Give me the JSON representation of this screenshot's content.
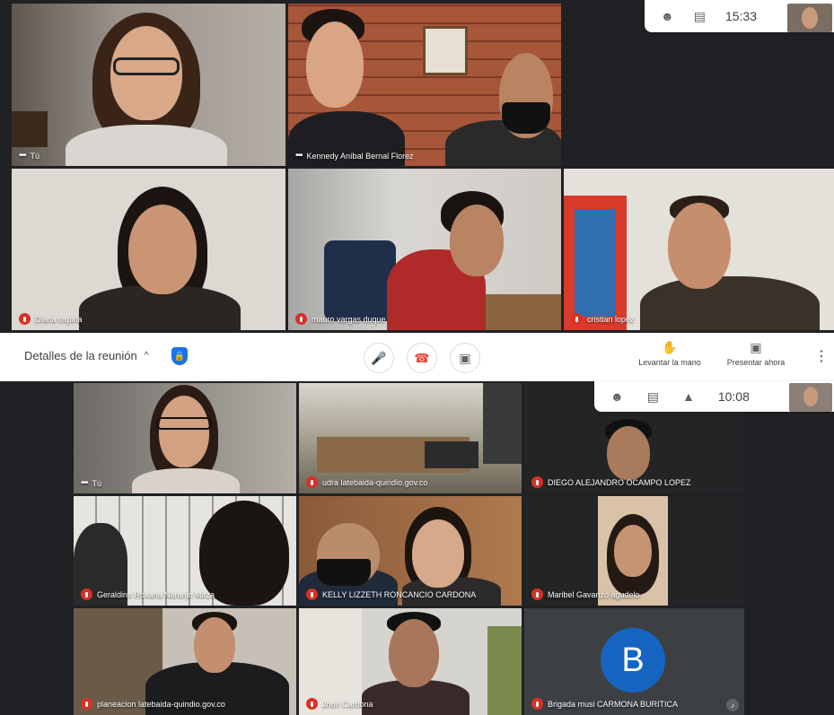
{
  "top_call": {
    "toolbar": {
      "people_icon": "people-icon",
      "chat_icon": "chat-icon",
      "time": "15:33"
    },
    "participants": [
      {
        "name": "Tú"
      },
      {
        "name": "Kennedy Aníbal Bernal Florez"
      },
      {
        "name": "Diana ospina"
      },
      {
        "name": "mauro vargas duque"
      },
      {
        "name": "cristian lopez"
      }
    ]
  },
  "controls": {
    "meeting_details": "Detalles de la reunión",
    "raise_hand": "Levantar la mano",
    "present_now": "Presentar ahora"
  },
  "bottom_call": {
    "toolbar": {
      "time": "10:08"
    },
    "participants": [
      {
        "name": "Tú"
      },
      {
        "name": "udra latebaida-quindio.gov.co"
      },
      {
        "name": "DIEGO ALEJANDRO OCAMPO LOPEZ"
      },
      {
        "name": "Geraldine Roxana Naranjo Mirza"
      },
      {
        "name": "KELLY LIZZETH RONCANCIO CARDONA"
      },
      {
        "name": "Maribel Gavanzo agudelo"
      },
      {
        "name": "planeacion latebaida-quindio.gov.co"
      },
      {
        "name": "Jhon Cardona"
      },
      {
        "name": "Brigada musi CARMONA BURITICA",
        "avatar_letter": "B"
      }
    ]
  },
  "colors": {
    "mic_off": "#d93025",
    "end_call": "#ea4335",
    "avatar_blue": "#1565c0"
  }
}
